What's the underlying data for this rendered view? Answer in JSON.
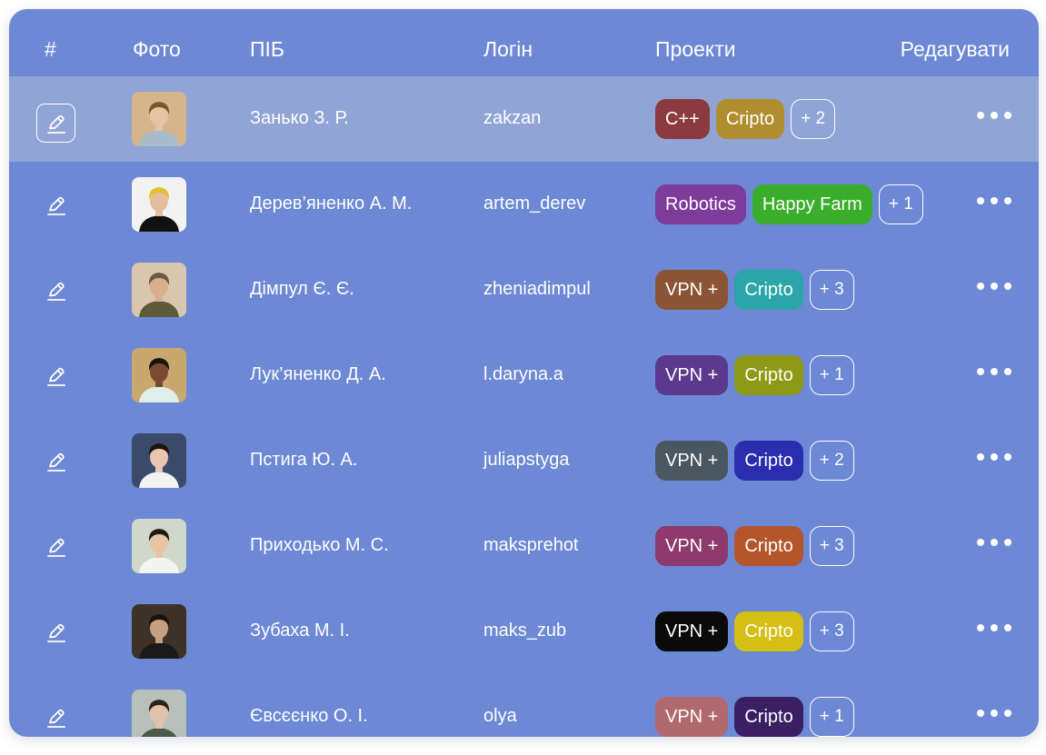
{
  "header": {
    "num": "#",
    "photo": "Фото",
    "name": "ПІБ",
    "login": "Логін",
    "projects": "Проекти",
    "edit": "Редагувати"
  },
  "icons": {
    "edit": "pencil-edit-icon",
    "more": "more-dots-icon"
  },
  "colors": {
    "background": "#6d88d4",
    "selected_row": "#90a4d6"
  },
  "rows": [
    {
      "name": "Занько З. Р.",
      "login": "zakzan",
      "selected": true,
      "tags": [
        {
          "label": "C++",
          "color": "#8b3a3f"
        },
        {
          "label": "Cripto",
          "color": "#b08d2e"
        }
      ],
      "more": "+ 2",
      "avatar": {
        "bg": "#d7b58b",
        "hair": "#7a5630",
        "shirt": "#a9bccb",
        "skin": "#e8c3a2"
      }
    },
    {
      "name": "Дерев’яненко А. М.",
      "login": "artem_derev",
      "selected": false,
      "tags": [
        {
          "label": "Robotics",
          "color": "#7d3c9a"
        },
        {
          "label": "Happy Farm",
          "color": "#3aae2b"
        }
      ],
      "more": "+ 1",
      "avatar": {
        "bg": "#f2f2f2",
        "hair": "#e4c22e",
        "shirt": "#111111",
        "skin": "#e5bea0"
      }
    },
    {
      "name": "Дімпул Є. Є.",
      "login": "zheniadimpul",
      "selected": false,
      "tags": [
        {
          "label": "VPN +",
          "color": "#8b5535"
        },
        {
          "label": "Cripto",
          "color": "#2aa5a8"
        }
      ],
      "more": "+ 3",
      "avatar": {
        "bg": "#d9c6ae",
        "hair": "#6b5a3d",
        "shirt": "#5d5a3a",
        "skin": "#d8b08c"
      }
    },
    {
      "name": "Лук’яненко Д. А.",
      "login": "l.daryna.a",
      "selected": false,
      "tags": [
        {
          "label": "VPN +",
          "color": "#5b3a8e"
        },
        {
          "label": "Cripto",
          "color": "#8e9a17"
        }
      ],
      "more": "+ 1",
      "avatar": {
        "bg": "#c9a86e",
        "hair": "#1a1411",
        "shirt": "#dfeee8",
        "skin": "#7a4a30"
      }
    },
    {
      "name": "Пстига Ю. А.",
      "login": "juliapstyga",
      "selected": false,
      "tags": [
        {
          "label": "VPN +",
          "color": "#4a5760"
        },
        {
          "label": "Cripto",
          "color": "#2a2eae"
        }
      ],
      "more": "+ 2",
      "avatar": {
        "bg": "#3a4a6a",
        "hair": "#1c1412",
        "shirt": "#f2f2f2",
        "skin": "#e9c6b0"
      }
    },
    {
      "name": "Приходько М. С.",
      "login": "maksprehot",
      "selected": false,
      "tags": [
        {
          "label": "VPN +",
          "color": "#8e3a6e"
        },
        {
          "label": "Cripto",
          "color": "#b4552a"
        }
      ],
      "more": "+ 3",
      "avatar": {
        "bg": "#cfd9c9",
        "hair": "#1e1a16",
        "shirt": "#f4f4f0",
        "skin": "#e6c4a4"
      }
    },
    {
      "name": "Зубаха М. І.",
      "login": "maks_zub",
      "selected": false,
      "tags": [
        {
          "label": "VPN +",
          "color": "#0a0a0a"
        },
        {
          "label": "Cripto",
          "color": "#d4bf14"
        }
      ],
      "more": "+ 3",
      "avatar": {
        "bg": "#3e3228",
        "hair": "#1a1410",
        "shirt": "#1a1a1a",
        "skin": "#c4a080"
      }
    },
    {
      "name": "Євсєєнко О. І.",
      "login": "olya",
      "selected": false,
      "tags": [
        {
          "label": "VPN +",
          "color": "#b06a6e"
        },
        {
          "label": "Cripto",
          "color": "#3a1f63"
        }
      ],
      "more": "+ 1",
      "avatar": {
        "bg": "#b8c0bc",
        "hair": "#2a2320",
        "shirt": "#4a5a48",
        "skin": "#e3c2ab"
      }
    }
  ]
}
